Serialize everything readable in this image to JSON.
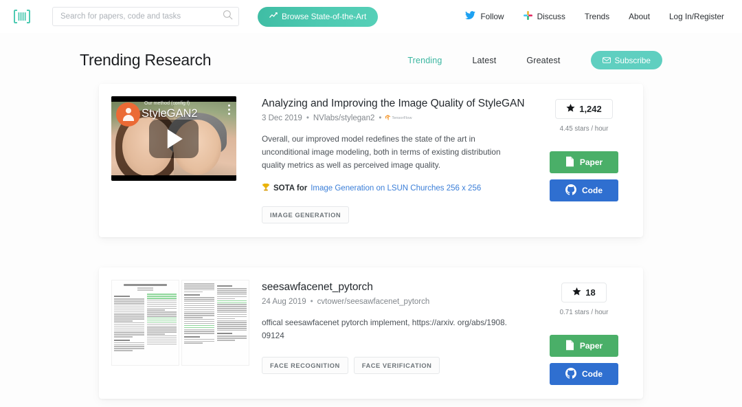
{
  "nav": {
    "logo_icon": "papers-with-code-logo",
    "search": {
      "placeholder": "Search for papers, code and tasks",
      "value": "",
      "icon": "search-icon"
    },
    "browse_button": {
      "label": "Browse State-of-the-Art",
      "icon": "chart-icon"
    },
    "links": [
      {
        "label": "Follow",
        "icon": "twitter-icon"
      },
      {
        "label": "Discuss",
        "icon": "slack-icon"
      },
      {
        "label": "Trends",
        "icon": ""
      },
      {
        "label": "About",
        "icon": ""
      },
      {
        "label": "Log In/Register",
        "icon": ""
      }
    ]
  },
  "page": {
    "title": "Trending Research",
    "filters": [
      {
        "label": "Trending",
        "active": true
      },
      {
        "label": "Latest",
        "active": false
      },
      {
        "label": "Greatest",
        "active": false
      }
    ],
    "subscribe_button": {
      "label": "Subscribe",
      "icon": "envelope-icon"
    }
  },
  "colors": {
    "accent_teal": "#3ab6a0",
    "subscribe_teal": "#5fcfc0",
    "paper_green": "#4aaf68",
    "code_blue": "#2f6fd0",
    "link_blue": "#3a7ed8",
    "page_bg": "#fdfdfd"
  },
  "cards": [
    {
      "thumbnail": {
        "type": "video",
        "overlay_caption": "Our method (config f)",
        "overlay_title": "StyleGAN2",
        "avatar_icon": "user-avatar-icon",
        "play_icon": "play-icon",
        "menu_icon": "kebab-menu-icon"
      },
      "title": "Analyzing and Improving the Image Quality of StyleGAN",
      "date": "3 Dec 2019",
      "repo": "NVlabs/stylegan2",
      "framework": "TensorFlow",
      "abstract": "Overall, our improved model redefines the state of the art in unconditional image modeling, both in terms of existing distribution quality metrics as well as perceived image quality.",
      "sota": {
        "icon": "trophy-icon",
        "label": "SOTA for",
        "link": "Image Generation on LSUN Churches 256 x 256"
      },
      "tags": [
        "IMAGE GENERATION"
      ],
      "stars": "1,242",
      "star_icon": "star-icon",
      "stars_rate": "4.45 stars / hour",
      "paper_button": {
        "label": "Paper",
        "icon": "document-icon"
      },
      "code_button": {
        "label": "Code",
        "icon": "github-icon"
      }
    },
    {
      "thumbnail": {
        "type": "paper-preview"
      },
      "title": "seesawfacenet_pytorch",
      "date": "24 Aug 2019",
      "repo": "cvtower/seesawfacenet_pytorch",
      "framework": "",
      "abstract": "offical seesawfacenet pytorch implement, https://arxiv. org/abs/1908. 09124",
      "sota": null,
      "tags": [
        "FACE RECOGNITION",
        "FACE VERIFICATION"
      ],
      "stars": "18",
      "star_icon": "star-icon",
      "stars_rate": "0.71 stars / hour",
      "paper_button": {
        "label": "Paper",
        "icon": "document-icon"
      },
      "code_button": {
        "label": "Code",
        "icon": "github-icon"
      }
    }
  ]
}
